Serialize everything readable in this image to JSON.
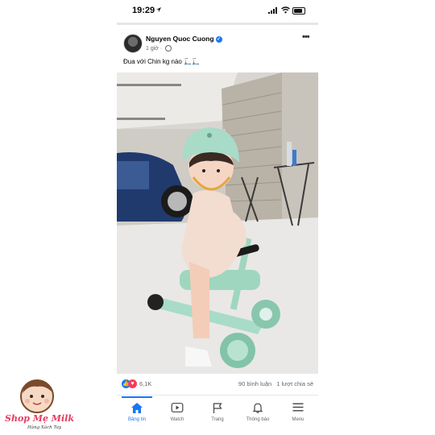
{
  "status_bar": {
    "time": "19:29"
  },
  "post": {
    "author": "Nguyen Quoc Cuong",
    "time_ago": "1 giờ",
    "caption": "Đua với Chin kg nào 🛴🛴",
    "reaction_count": "6,1K",
    "comments": "90 bình luận",
    "shares": "1 lượt chia sẻ"
  },
  "tabbar": {
    "items": [
      {
        "label": "Bảng tin",
        "icon": "home-icon",
        "active": true
      },
      {
        "label": "Watch",
        "icon": "video-icon",
        "active": false
      },
      {
        "label": "Trang",
        "icon": "flag-icon",
        "active": false
      },
      {
        "label": "Thông báo",
        "icon": "bell-icon",
        "active": false
      },
      {
        "label": "Menu",
        "icon": "menu-icon",
        "active": false
      }
    ]
  },
  "watermark": {
    "brand": "Shop Mẹ Milk",
    "tagline": "Hàng Xách Tay"
  },
  "colors": {
    "accent": "#1877f2",
    "love": "#f33e58",
    "brand": "#e23d5f",
    "helmet": "#a8dcc8"
  }
}
